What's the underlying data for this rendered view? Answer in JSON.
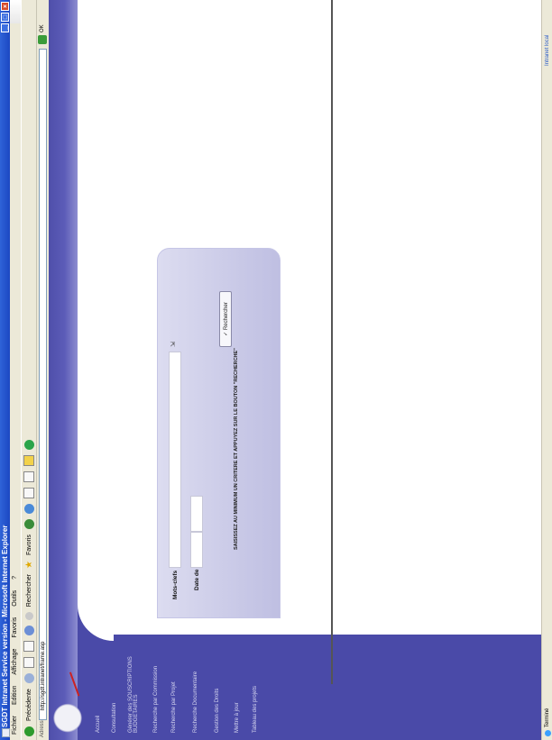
{
  "window": {
    "title": "SGDT Intranet Service version - Microsoft Internet Explorer",
    "buttons": [
      "_",
      "□",
      "×"
    ]
  },
  "menubar": [
    "Fichier",
    "Edition",
    "Affichage",
    "Favoris",
    "Outils",
    "?"
  ],
  "toolbar": {
    "back_label": "Précédente",
    "search_label": "Rechercher",
    "favorites_label": "Favoris"
  },
  "addressbar": {
    "label": "Adresse",
    "url": "http://sgdt.intranet/frame.asp",
    "go_label": "OK"
  },
  "sidebar": {
    "items": [
      "Accueil",
      "Consultation",
      "Générer des SOUSCRIPTIONS BUDGETAIRES",
      "Recherche par Commission",
      "Recherche par Projet",
      "Recherche Documentaire",
      "Gestion des Droits",
      "Mettre à jour",
      "Tableau des projets"
    ]
  },
  "search": {
    "keywords_label": "Mots-clefs",
    "date_label": "Date de",
    "button_label": "Rechercher",
    "instruction": "SAISISSEZ AU MINIMUM UN CRITERE ET APPUYEZ SUR LE BOUTON \"RECHERCHE\""
  },
  "statusbar": {
    "left": "Terminé",
    "right": "Intranet local"
  }
}
